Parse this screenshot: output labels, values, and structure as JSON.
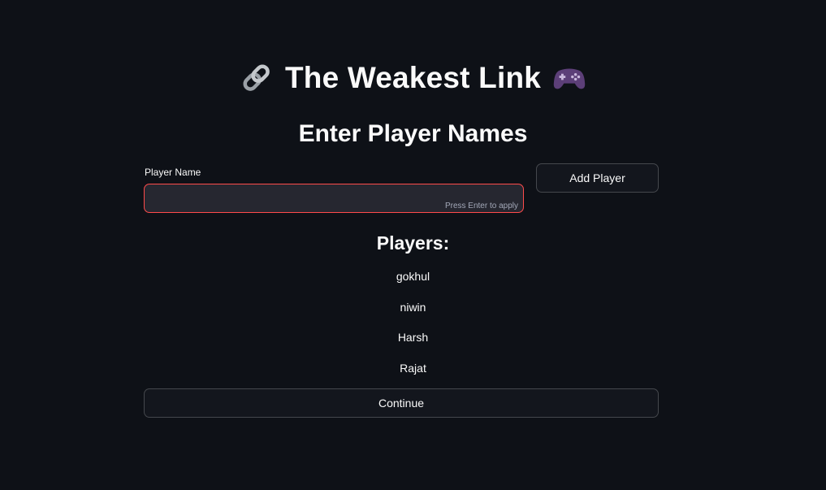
{
  "header": {
    "title": "The Weakest Link",
    "left_icon": "link-icon",
    "right_icon": "game-controller-icon"
  },
  "subtitle": "Enter Player Names",
  "player_form": {
    "label": "Player Name",
    "value": "",
    "hint": "Press Enter to apply",
    "add_button_label": "Add Player"
  },
  "players": {
    "heading": "Players:",
    "names": [
      "gokhul",
      "niwin",
      "Harsh",
      "Rajat"
    ]
  },
  "continue_button_label": "Continue",
  "colors": {
    "background": "#0e1117",
    "text": "#fafafa",
    "input_background": "#262730",
    "input_focus_border": "#ff4b4b",
    "button_background": "#13161d"
  }
}
